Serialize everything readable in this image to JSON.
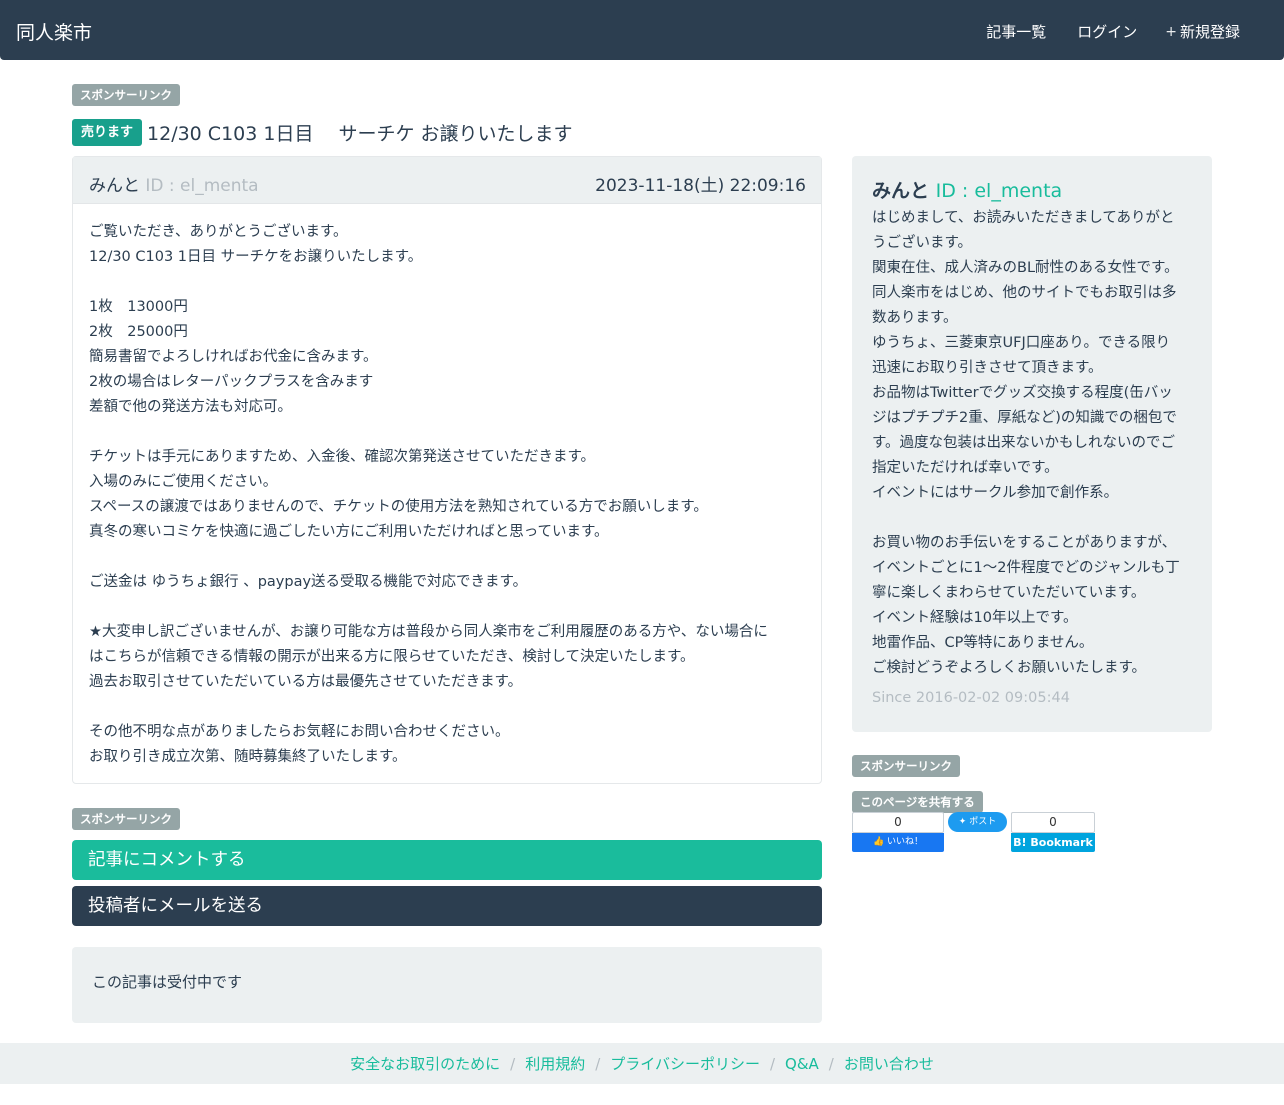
{
  "nav": {
    "brand": "同人楽市",
    "items": [
      {
        "icon": "list-icon",
        "glyph": "",
        "label": "記事一覧"
      },
      {
        "icon": "login-icon",
        "glyph": "",
        "label": "ログイン"
      },
      {
        "icon": "plus-icon",
        "glyph": "+",
        "label": "新規登録"
      }
    ]
  },
  "sponsor_label": "スポンサーリンク",
  "share_label": "このページを共有する",
  "post": {
    "badge": "売ります",
    "title": "12/30 C103 1日目　 サーチケ お譲りいたします",
    "user_icon": "",
    "user_name": "みんと",
    "user_id": "ID : el_menta",
    "date_icon": "",
    "date": "2023-11-18(土) 22:09:16",
    "body_lines": [
      "ご覧いただき、ありがとうございます。",
      "12/30 C103 1日目 サーチケをお譲りいたします。",
      "",
      "1枚　13000円",
      "2枚　25000円",
      "簡易書留でよろしければお代金に含みます。",
      "2枚の場合はレターパックプラスを含みます",
      "差額で他の発送方法も対応可。",
      "",
      "チケットは手元にありますため、入金後、確認次第発送させていただきます。",
      "入場のみにご使用ください。",
      "スペースの譲渡ではありませんので、チケットの使用方法を熟知されている方でお願いします。",
      "真冬の寒いコミケを快適に過ごしたい方にご利用いただければと思っています。",
      "",
      "ご送金は ゆうちょ銀行 、paypay送る受取る機能で対応できます。",
      "",
      "★大変申し訳ございませんが、お譲り可能な方は普段から同人楽市をご利用履歴のある方や、ない場合に",
      "はこちらが信頼できる情報の開示が出来る方に限らせていただき、検討して決定いたします。",
      "過去お取引させていただいている方は最優先させていただきます。",
      "",
      "その他不明な点がありましたらお気軽にお問い合わせください。",
      "お取り引き成立次第、随時募集終了いたします。"
    ]
  },
  "actions": {
    "comment": "記事にコメントする",
    "mail": "投稿者にメールを送る",
    "status": "この記事は受付中です"
  },
  "profile": {
    "user_icon": "",
    "name": "みんと",
    "id": "ID : el_menta",
    "lines": [
      "はじめまして、お読みいただきましてありがと",
      "うございます。",
      "関東在住、成人済みのBL耐性のある女性です。",
      "同人楽市をはじめ、他のサイトでもお取引は多",
      "数あります。",
      "ゆうちょ、三菱東京UFJ口座あり。できる限り",
      "迅速にお取り引きさせて頂きます。",
      "お品物はTwitterでグッズ交換する程度(缶バッ",
      "ジはプチプチ2重、厚紙など)の知識での梱包で",
      "す。過度な包装は出来ないかもしれないのでご",
      "指定いただければ幸いです。",
      "イベントにはサークル参加で創作系。",
      "",
      "お買い物のお手伝いをすることがありますが、",
      "イベントごとに1〜2件程度でどのジャンルも丁",
      "寧に楽しくまわらせていただいています。",
      "イベント経験は10年以上です。",
      "地雷作品、CP等特にありません。",
      "ご検討どうぞよろしくお願いいたします。"
    ],
    "since_icon": "",
    "since": "Since 2016-02-02 09:05:44"
  },
  "share": {
    "fb_count": "0",
    "fb_label": "いいね！",
    "tw_label": "ポスト",
    "hb_count": "0",
    "hb_label": "B! Bookmark"
  },
  "footer": {
    "links": [
      "安全なお取引のために",
      "利用規約",
      "プライバシーポリシー",
      "Q&A",
      "お問い合わせ"
    ],
    "separator": "/"
  }
}
